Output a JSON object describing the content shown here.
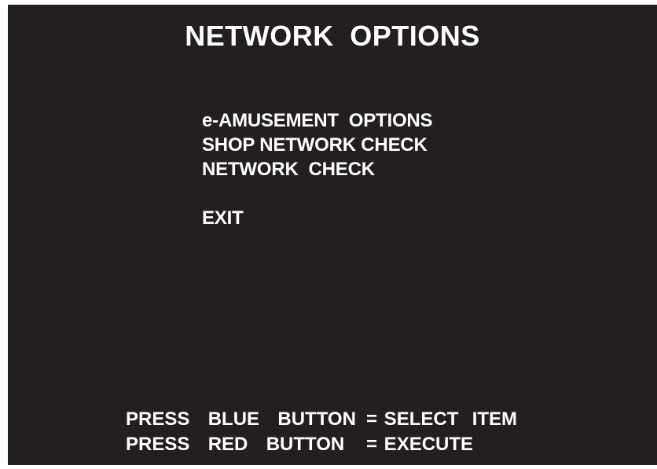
{
  "title": "NETWORK  OPTIONS",
  "menu": {
    "items": [
      {
        "label": "e-AMUSEMENT  OPTIONS"
      },
      {
        "label": "SHOP NETWORK CHECK"
      },
      {
        "label": "NETWORK  CHECK"
      },
      {
        "label": "EXIT"
      }
    ]
  },
  "footer": {
    "lines": [
      {
        "left": "PRESS  BLUE  BUTTON",
        "right": "= SELECT  ITEM"
      },
      {
        "left": "PRESS  RED  BUTTON",
        "right": "= EXECUTE"
      }
    ]
  },
  "colors": {
    "background": "#231f20",
    "text": "#ffffff",
    "frame": "#ffffff"
  }
}
